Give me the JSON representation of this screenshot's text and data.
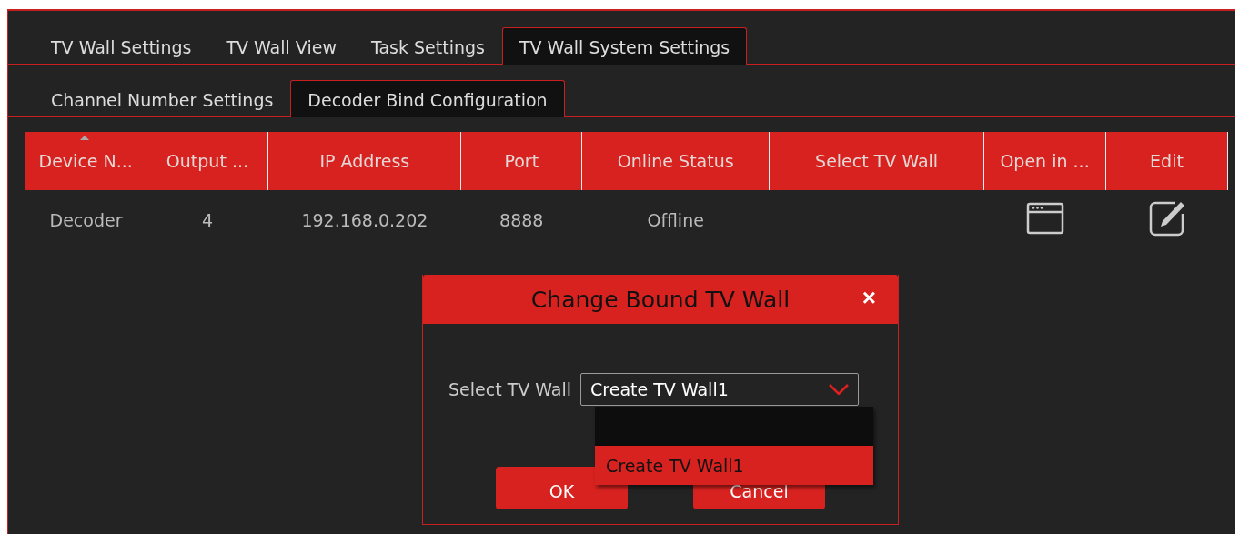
{
  "tabs": [
    {
      "label": "TV Wall Settings",
      "selected": false
    },
    {
      "label": "TV Wall View",
      "selected": false
    },
    {
      "label": "Task Settings",
      "selected": false
    },
    {
      "label": "TV Wall System Settings",
      "selected": true
    }
  ],
  "subtabs": [
    {
      "label": "Channel Number Settings",
      "selected": false
    },
    {
      "label": "Decoder Bind Configuration",
      "selected": true
    }
  ],
  "table": {
    "columns": [
      {
        "label": "Device N...",
        "sorted": true
      },
      {
        "label": "Output ...",
        "sorted": false
      },
      {
        "label": "IP Address",
        "sorted": false
      },
      {
        "label": "Port",
        "sorted": false
      },
      {
        "label": "Online Status",
        "sorted": false
      },
      {
        "label": "Select TV Wall",
        "sorted": false
      },
      {
        "label": "Open in ...",
        "sorted": false
      },
      {
        "label": "Edit",
        "sorted": false
      }
    ],
    "rows": [
      {
        "cells": [
          "Decoder",
          "4",
          "192.168.0.202",
          "8888",
          "Offline"
        ]
      }
    ]
  },
  "dialog": {
    "title": "Change Bound TV Wall",
    "close": "×",
    "field_label": "Select TV Wall",
    "select": {
      "value": "Create TV Wall1",
      "expanded": true
    },
    "options": [
      {
        "kind": "blank",
        "selected": false
      },
      {
        "kind": "text",
        "label": "Create TV Wall1",
        "selected": true
      }
    ],
    "buttons": [
      "OK",
      "Cancel"
    ]
  }
}
